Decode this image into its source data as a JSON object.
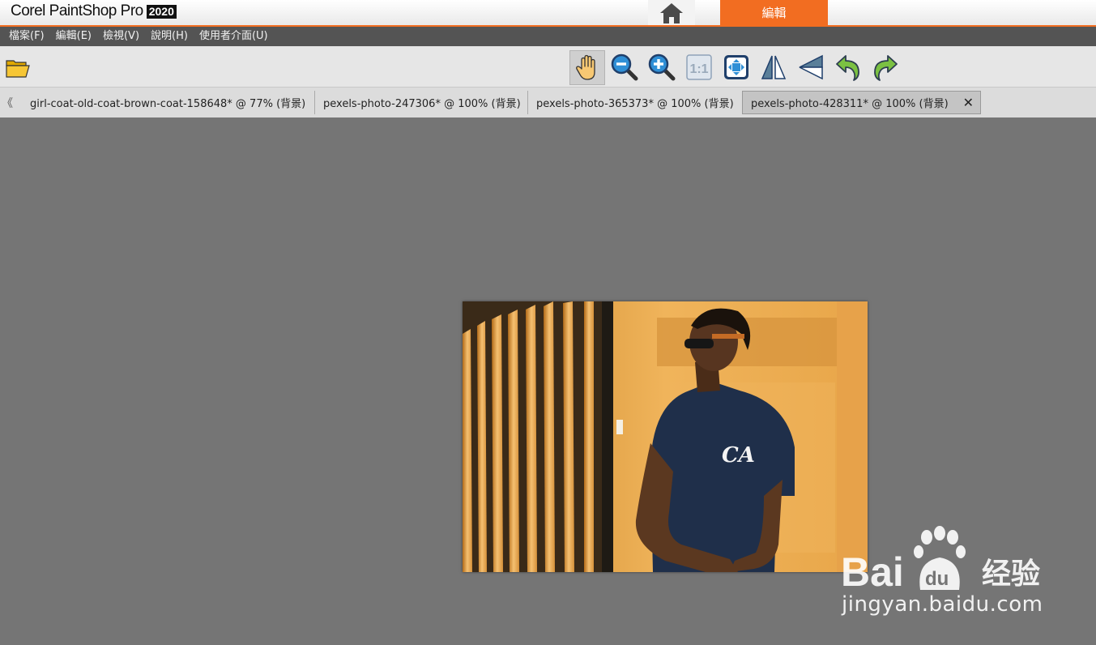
{
  "app": {
    "brand": "Corel PaintShop Pro",
    "year": "2020",
    "edit_tab": "編輯",
    "accent_color": "#f26d21"
  },
  "menu": [
    {
      "label": "檔案(F)"
    },
    {
      "label": "編輯(E)"
    },
    {
      "label": "檢視(V)"
    },
    {
      "label": "說明(H)"
    },
    {
      "label": "使用者介面(U)"
    }
  ],
  "toolbar": {
    "icons": [
      "open-folder-icon",
      "pan-hand-icon",
      "zoom-out-icon",
      "zoom-in-icon",
      "actual-size-icon",
      "fit-window-icon",
      "flip-horizontal-icon",
      "flip-vertical-icon",
      "undo-icon",
      "redo-icon"
    ],
    "actual_size_label": "1:1"
  },
  "tabs": {
    "scroll_glyph": "《",
    "items": [
      {
        "label": "girl-coat-old-coat-brown-coat-158648* @  77% (背景)"
      },
      {
        "label": "pexels-photo-247306* @ 100% (背景)"
      },
      {
        "label": "pexels-photo-365373* @ 100% (背景)"
      },
      {
        "label": "pexels-photo-428311* @ 100% (背景)",
        "active": true
      }
    ],
    "close_glyph": "✕"
  },
  "canvas": {
    "photo_shirt_text": "CA"
  },
  "watermark": {
    "logo_text": "Bai",
    "logo_text2": "du",
    "logo_cn": "经验",
    "url": "jingyan.baidu.com"
  }
}
